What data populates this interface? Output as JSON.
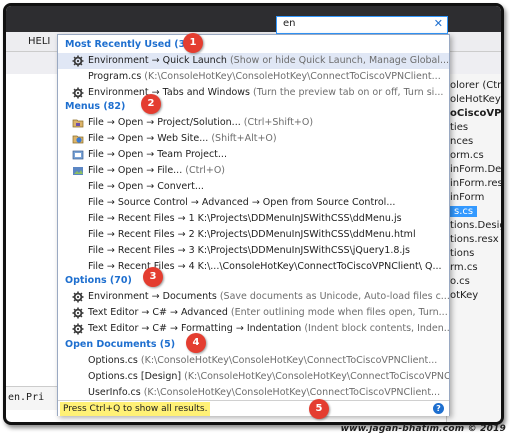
{
  "background": {
    "menu_help": "HELI",
    "code_snippet": "en.Pri",
    "solution_items": [
      "olorer (Ctrl-",
      "oleHotKey",
      "oCiscoVPN",
      "ties",
      "nces",
      "orm.cs",
      "inForm.Des",
      "inForm.res",
      "inForm",
      "s.cs",
      "tions.Design",
      "tions.resx",
      "tions",
      "rm.cs",
      "o.cs",
      "otKey"
    ]
  },
  "search": {
    "query": "en",
    "clear_label": "✕"
  },
  "groups": {
    "recent": {
      "title": "Most Recently Used (3)"
    },
    "menus": {
      "title": "Menus (82)"
    },
    "options": {
      "title": "Options (70)"
    },
    "open_docs": {
      "title": "Open Documents (5)"
    }
  },
  "results": {
    "recent": [
      {
        "icon": "gear-icon",
        "main": "Environment → Quick Launch",
        "desc": " (Show or hide Quick Launch, Manage Global..."
      },
      {
        "icon": "",
        "main": "Program.cs",
        "desc": " (K:\\ConsoleHotKey\\ConsoleHotKey\\ConnectToCiscoVPNClient..."
      },
      {
        "icon": "gear-icon",
        "main": "Environment → Tabs and Windows",
        "desc": " (Turn the preview tab on or off, Turn si..."
      }
    ],
    "menus": [
      {
        "icon": "open-project-icon",
        "main": "File → Open → Project/Solution...",
        "desc": " (Ctrl+Shift+O)"
      },
      {
        "icon": "web-icon",
        "main": "File → Open → Web Site...",
        "desc": " (Shift+Alt+O)"
      },
      {
        "icon": "team-project-icon",
        "main": "File → Open → Team Project...",
        "desc": ""
      },
      {
        "icon": "open-file-icon",
        "main": "File → Open → File...",
        "desc": " (Ctrl+O)"
      },
      {
        "icon": "",
        "main": "File → Open → Convert...",
        "desc": ""
      },
      {
        "icon": "",
        "main": "File → Source Control → Advanced → Open from Source Control...",
        "desc": ""
      },
      {
        "icon": "",
        "main": "File → Recent Files → 1 K:\\Projects\\DDMenuInJSWithCSS\\ddMenu.js",
        "desc": ""
      },
      {
        "icon": "",
        "main": "File → Recent Files → 2 K:\\Projects\\DDMenuInJSWithCSS\\ddMenu.html",
        "desc": ""
      },
      {
        "icon": "",
        "main": "File → Recent Files → 3 K:\\Projects\\DDMenuInJSWithCSS\\jQuery1.8.js",
        "desc": ""
      },
      {
        "icon": "",
        "main": "File → Recent Files → 4 K:\\...\\ConsoleHotKey\\ConnectToCiscoVPNClient\\ Q...",
        "desc": ""
      }
    ],
    "options": [
      {
        "icon": "gear-icon",
        "main": "Environment → Documents",
        "desc": " (Save documents as Unicode, Auto-load files c..."
      },
      {
        "icon": "gear-icon",
        "main": "Text Editor → C# → Advanced",
        "desc": " (Enter outlining mode when files open, Turn..."
      },
      {
        "icon": "gear-icon",
        "main": "Text Editor → C# → Formatting → Indentation",
        "desc": " (Indent block contents, Inden..."
      }
    ],
    "open_docs": [
      {
        "icon": "",
        "main": "Options.cs",
        "desc": " (K:\\ConsoleHotKey\\ConsoleHotKey\\ConnectToCiscoVPNClient..."
      },
      {
        "icon": "",
        "main": "Options.cs [Design]",
        "desc": " (K:\\ConsoleHotKey\\ConsoleHotKey\\ConnectToCiscoVPNClie..."
      },
      {
        "icon": "",
        "main": "UserInfo.cs",
        "desc": " (K:\\ConsoleHotKey\\ConsoleHotKey\\ConnectToCiscoVPNClient..."
      }
    ]
  },
  "footer": {
    "hint": "Press Ctrl+Q to show all results.",
    "help_label": "?"
  },
  "badges": [
    "1",
    "2",
    "3",
    "4",
    "5"
  ],
  "watermark": "www.jagan-bhatim.com © 2019",
  "colors": {
    "accent": "#1e6fcf",
    "selected_row": "#e0e7f5",
    "badge": "#e43d30",
    "hint_highlight": "#fff176"
  }
}
